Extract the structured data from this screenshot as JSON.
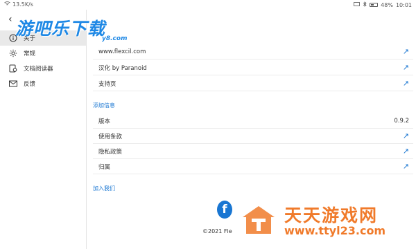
{
  "statusbar": {
    "speed": "13.5K/s",
    "battery": "48%",
    "time": "10:01"
  },
  "sidebar": {
    "items": [
      {
        "label": "关于",
        "icon": "info-icon",
        "active": true
      },
      {
        "label": "常规",
        "icon": "gear-icon",
        "active": false
      },
      {
        "label": "文档阅读器",
        "icon": "document-reader-icon",
        "active": false
      },
      {
        "label": "反馈",
        "icon": "mail-icon",
        "active": false
      }
    ]
  },
  "links": [
    {
      "label": "www.flexcil.com"
    },
    {
      "label": "汉化 by Paranoid"
    },
    {
      "label": "支持页"
    }
  ],
  "sections": {
    "add_info": "添加信息",
    "join_us": "加入我们"
  },
  "info_rows": [
    {
      "label": "版本",
      "value": "0.9.2"
    },
    {
      "label": "使用条款"
    },
    {
      "label": "隐私政策"
    },
    {
      "label": "归属"
    }
  ],
  "footer": {
    "copyright": "©2021 Fle"
  },
  "watermarks": {
    "top_big": "游吧乐下载",
    "top_small": "y8.com",
    "bottom_title": "天天游戏网",
    "bottom_url": "www.ttyl23.com"
  },
  "colors": {
    "accent": "#1976d2",
    "watermark_blue": "#1e88e5",
    "watermark_orange": "#f07a2a"
  }
}
